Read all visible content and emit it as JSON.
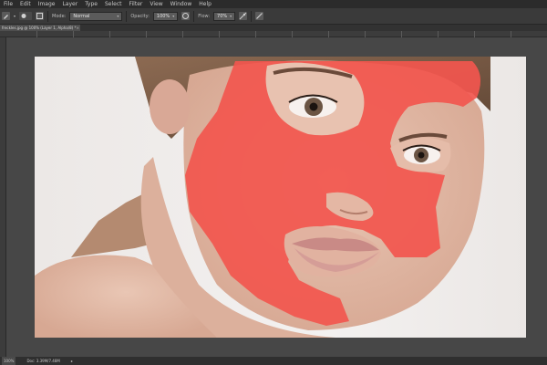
{
  "menubar": {
    "items": [
      "File",
      "Edit",
      "Image",
      "Layer",
      "Type",
      "Select",
      "Filter",
      "View",
      "Window",
      "Help"
    ]
  },
  "options": {
    "mode_label": "Mode:",
    "mode_value": "Normal",
    "opacity_label": "Opacity:",
    "opacity_value": "100%",
    "flow_label": "Flow:",
    "flow_value": "70%"
  },
  "document": {
    "tab_title": "freckles.jpg @ 100% (Layer 1, Alpha/8) *",
    "tab_close": "×"
  },
  "status": {
    "zoom": "100%",
    "doc": "Doc: 3.39M/7.48M"
  },
  "colors": {
    "mask_overlay": "#f2564e",
    "workspace": "#474747"
  }
}
